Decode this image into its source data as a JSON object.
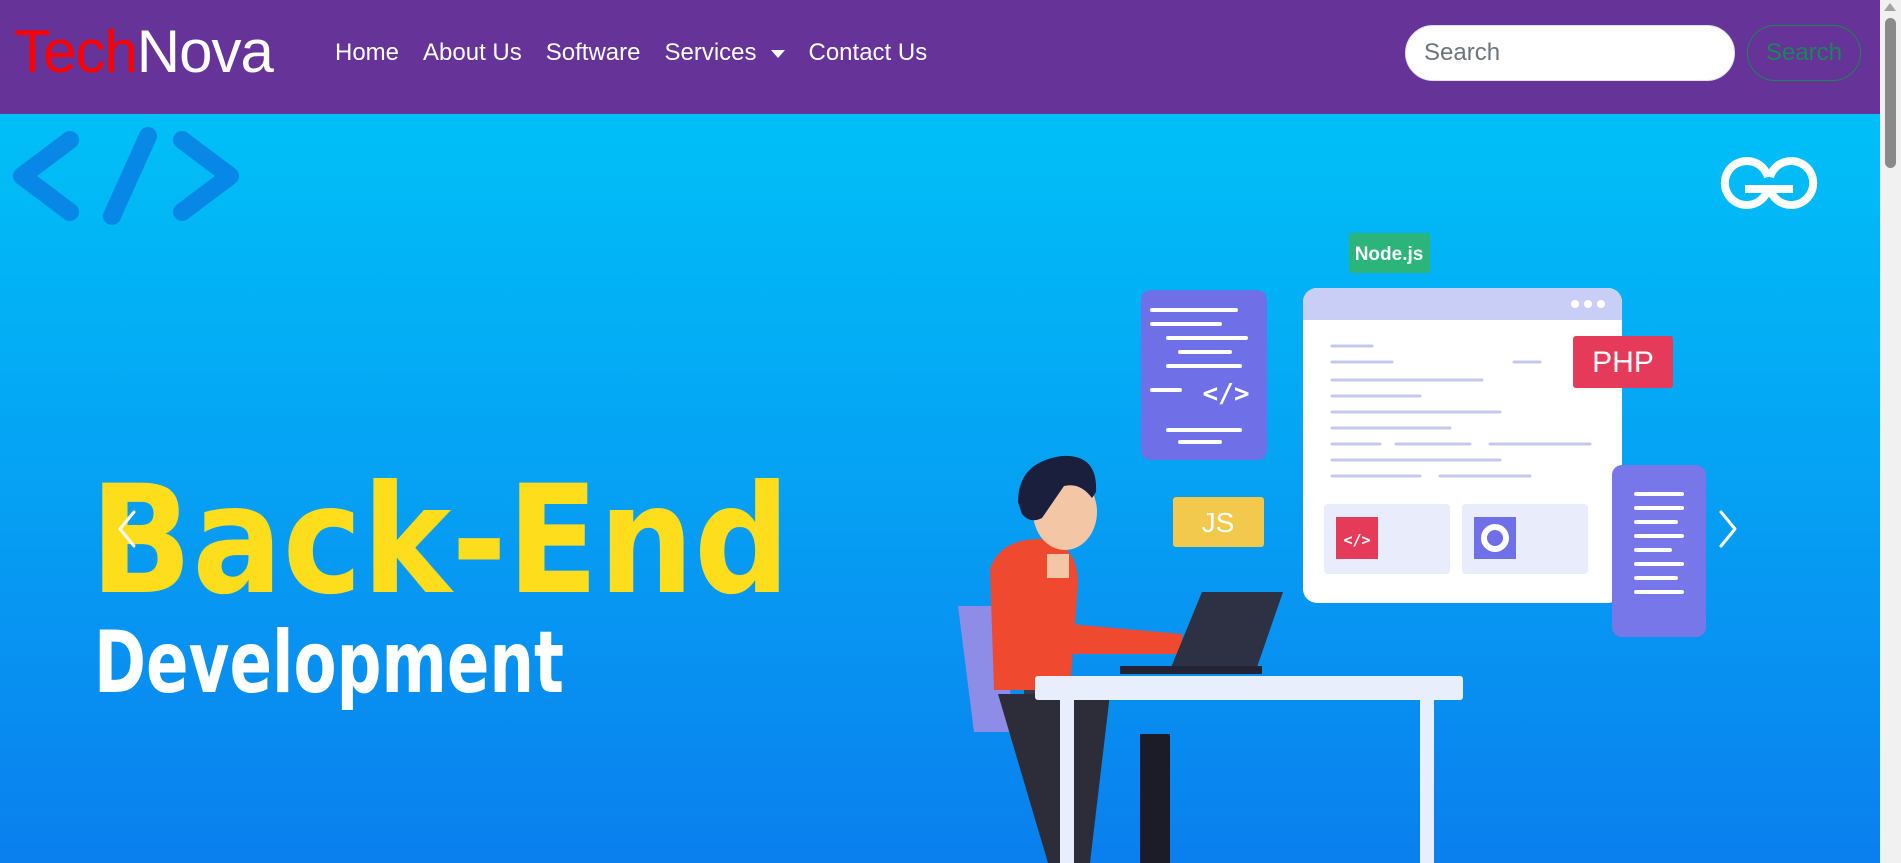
{
  "brand": {
    "part1": "Tech",
    "part2": "Nova",
    "part1_color": "#ff0000",
    "part2_color": "#ffffff"
  },
  "nav": {
    "background": "#663399",
    "links": [
      {
        "label": "Home"
      },
      {
        "label": "About Us"
      },
      {
        "label": "Software"
      },
      {
        "label": "Services",
        "has_dropdown": true
      },
      {
        "label": "Contact Us"
      }
    ]
  },
  "search": {
    "placeholder": "Search",
    "value": "",
    "button_label": "Search",
    "button_color": "#198754"
  },
  "hero": {
    "headline": "Back-End",
    "subheadline": "Development",
    "headline_color": "#fedd1c",
    "tags": {
      "node": "Node.js",
      "php": "PHP",
      "js": "JS",
      "code": "</>"
    },
    "prev_icon": "chevron-left-icon",
    "next_icon": "chevron-right-icon"
  }
}
